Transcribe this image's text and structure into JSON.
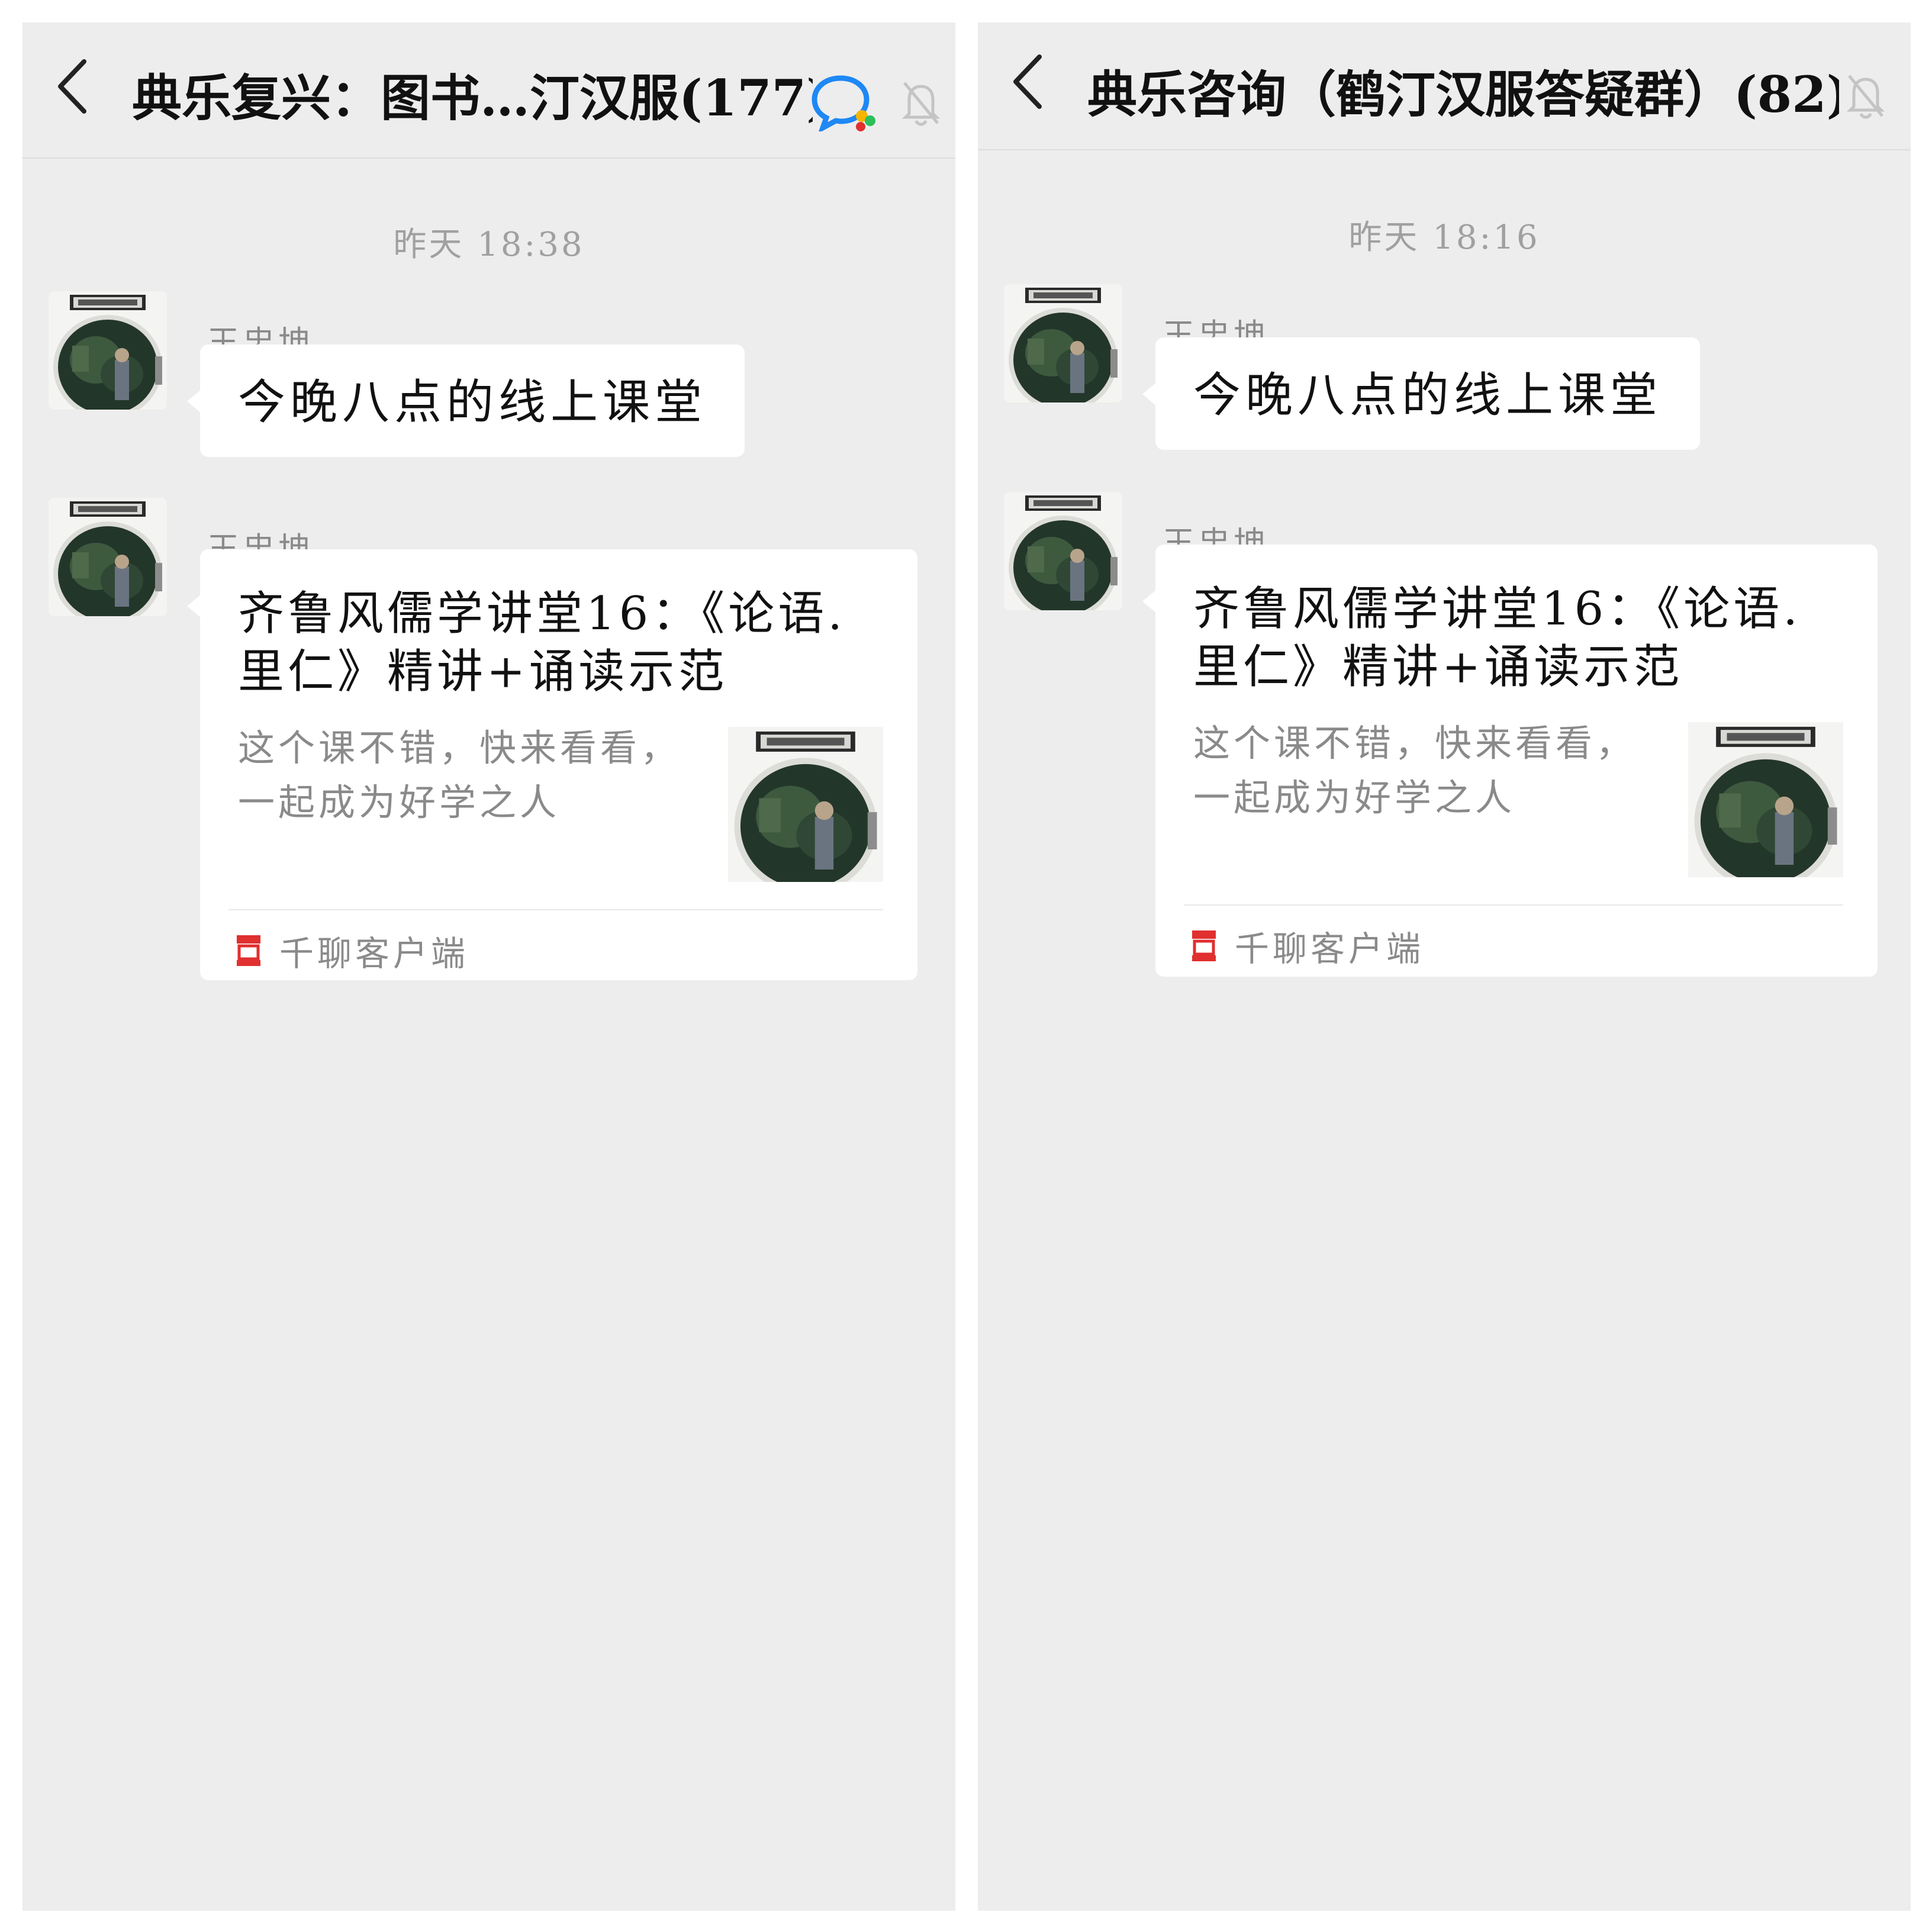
{
  "colors": {
    "background": "#ededed",
    "bubble": "#ffffff",
    "text_primary": "#111111",
    "text_secondary": "#8a8a8a",
    "qq_blue": "#1e88f5",
    "qianliao_red": "#e0302f"
  },
  "left": {
    "header": {
      "back_icon": "chevron-left-icon",
      "title": "典乐复兴：图书…汀汉服(177)",
      "icons": [
        "qq-chat-icon",
        "bell-muted-icon"
      ]
    },
    "timestamp": "昨天 18:38",
    "messages": [
      {
        "sender": "王忠坤",
        "avatar_icon": "avatar-photo",
        "text": "今晚八点的线上课堂"
      },
      {
        "sender": "王忠坤",
        "avatar_icon": "avatar-photo",
        "card": {
          "title": "齐鲁风儒学讲堂16：《论语.里仁》精讲+诵读示范",
          "description": "这个课不错，快来看看，一起成为好学之人",
          "thumbnail_icon": "card-thumbnail-photo",
          "source_icon": "qianliao-icon",
          "source": "千聊客户端"
        }
      }
    ]
  },
  "right": {
    "header": {
      "back_icon": "chevron-left-icon",
      "title": "典乐咨询（鹤汀汉服答疑群）(82)",
      "icons": [
        "bell-muted-icon"
      ]
    },
    "timestamp": "昨天 18:16",
    "messages": [
      {
        "sender": "王忠坤",
        "avatar_icon": "avatar-photo",
        "text": "今晚八点的线上课堂"
      },
      {
        "sender": "王忠坤",
        "avatar_icon": "avatar-photo",
        "card": {
          "title": "齐鲁风儒学讲堂16：《论语.里仁》精讲+诵读示范",
          "description": "这个课不错，快来看看，一起成为好学之人",
          "thumbnail_icon": "card-thumbnail-photo",
          "source_icon": "qianliao-icon",
          "source": "千聊客户端"
        }
      }
    ]
  }
}
